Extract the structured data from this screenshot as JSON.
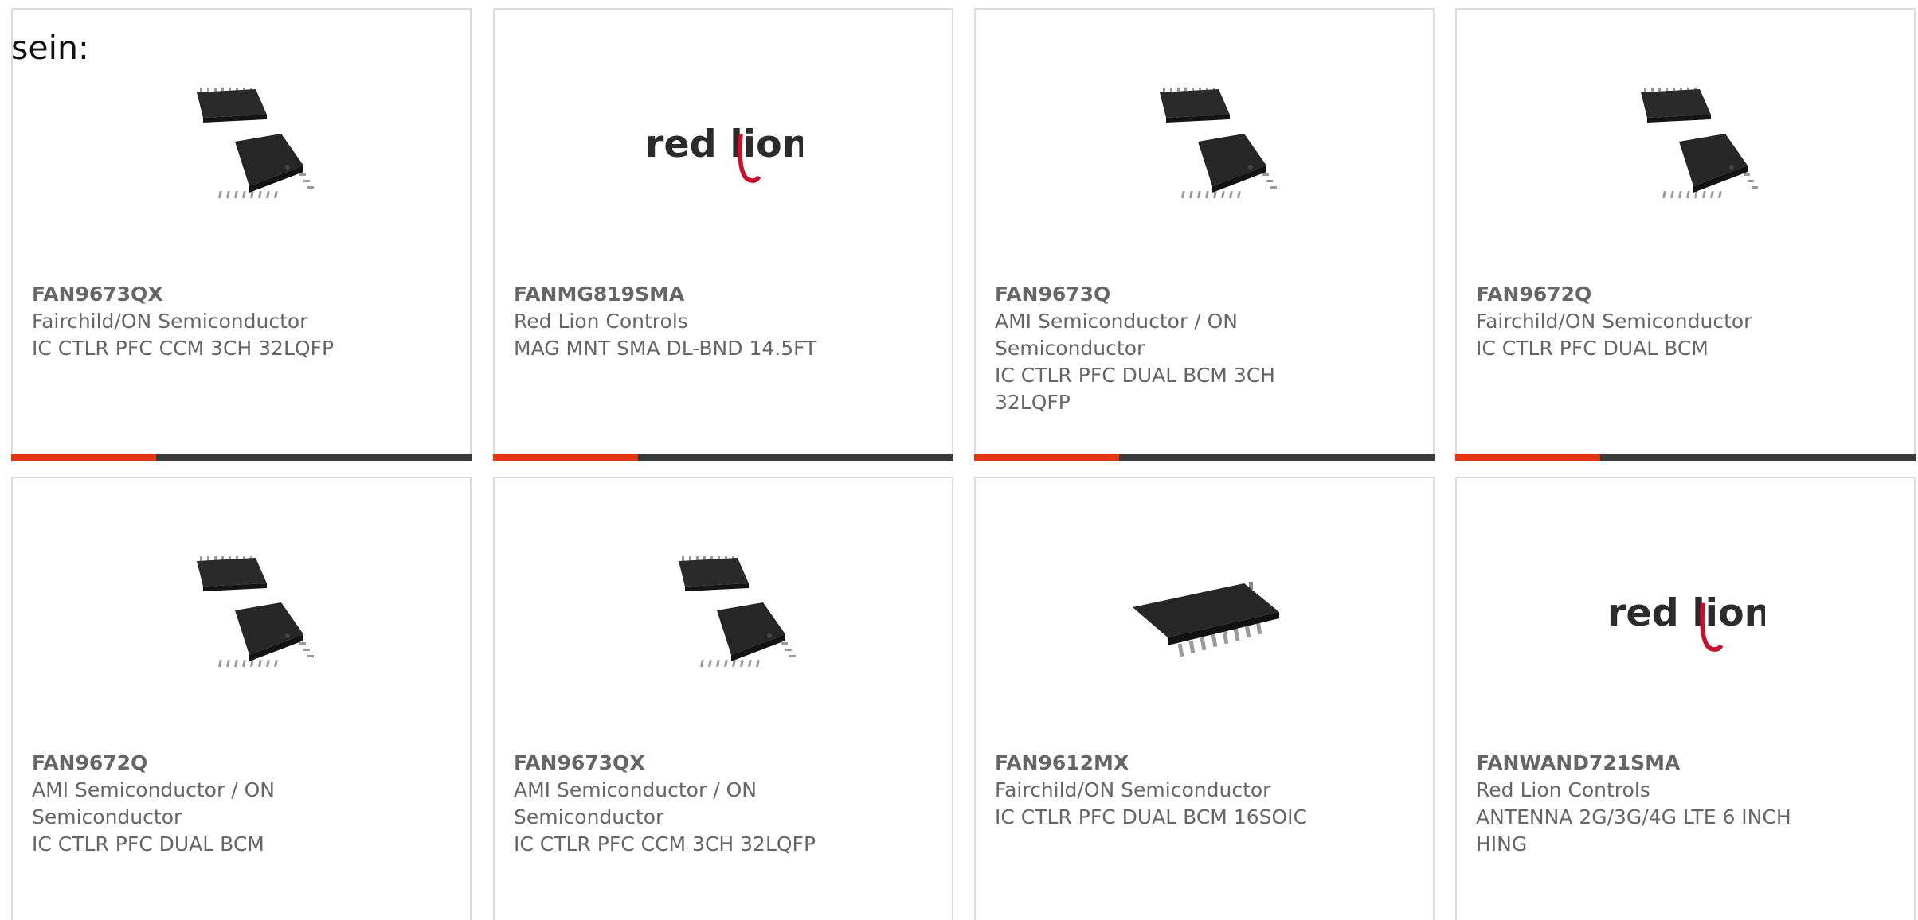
{
  "intro_text": "sein:",
  "accent_color": "#e4360c",
  "bar_color": "#3a3a3a",
  "products": [
    {
      "part": "FAN9673QX",
      "manufacturer": "Fairchild/ON Semiconductor",
      "description": "IC CTLR PFC CCM 3CH 32LQFP",
      "image": "qfp-chip-icon"
    },
    {
      "part": "FANMG819SMA",
      "manufacturer": "Red Lion Controls",
      "description": "MAG MNT SMA DL-BND 14.5FT",
      "image": "red-lion-logo",
      "logo_text": "red lion"
    },
    {
      "part": "FAN9673Q",
      "manufacturer": "AMI Semiconductor / ON Semiconductor",
      "description": "IC CTLR PFC DUAL BCM 3CH 32LQFP",
      "image": "qfp-chip-icon"
    },
    {
      "part": "FAN9672Q",
      "manufacturer": "Fairchild/ON Semiconductor",
      "description": "IC CTLR PFC DUAL BCM",
      "image": "qfp-chip-icon"
    },
    {
      "part": "FAN9672Q",
      "manufacturer": "AMI Semiconductor / ON Semiconductor",
      "description": "IC CTLR PFC DUAL BCM",
      "image": "qfp-chip-icon"
    },
    {
      "part": "FAN9673QX",
      "manufacturer": "AMI Semiconductor / ON Semiconductor",
      "description": "IC CTLR PFC CCM 3CH 32LQFP",
      "image": "qfp-chip-icon"
    },
    {
      "part": "FAN9612MX",
      "manufacturer": "Fairchild/ON Semiconductor",
      "description": "IC CTLR PFC DUAL BCM 16SOIC",
      "image": "soic-chip-icon"
    },
    {
      "part": "FANWAND721SMA",
      "manufacturer": "Red Lion Controls",
      "description": "ANTENNA 2G/3G/4G LTE 6 INCH HING",
      "image": "red-lion-logo",
      "logo_text": "red lion"
    }
  ]
}
